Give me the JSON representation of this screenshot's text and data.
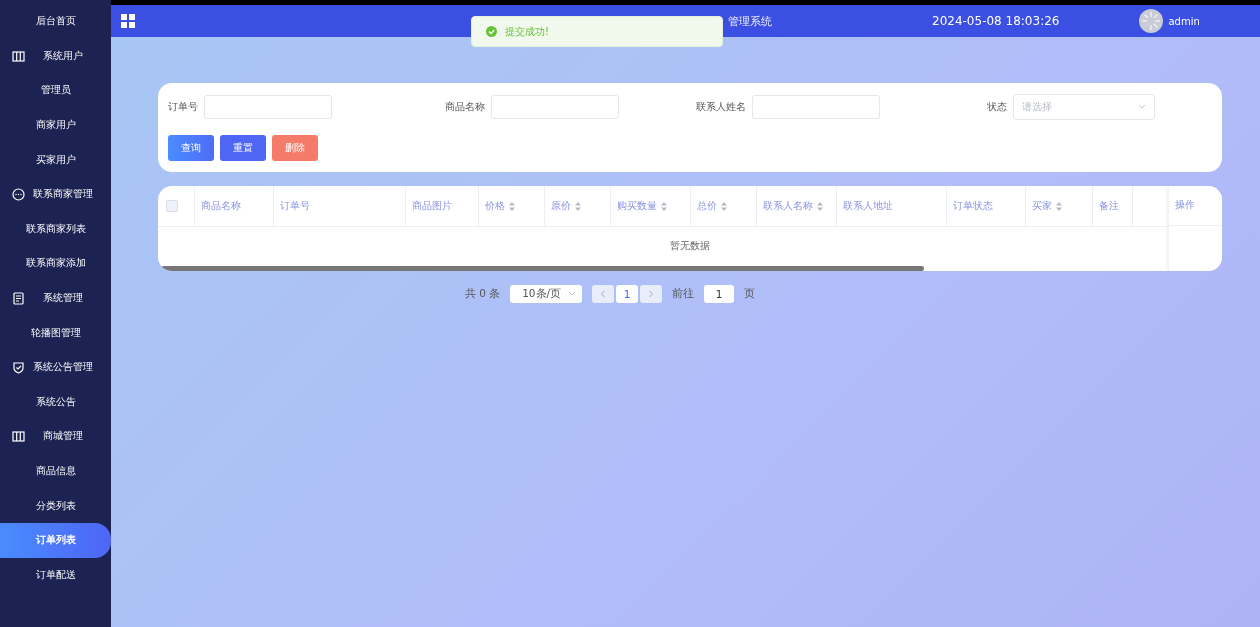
{
  "sidebar": {
    "items": [
      {
        "label": "后台首页",
        "kind": "item",
        "selected": false
      },
      {
        "label": "系统用户",
        "kind": "columns",
        "selected": false
      },
      {
        "label": "管理员",
        "kind": "item",
        "selected": false
      },
      {
        "label": "商家用户",
        "kind": "item",
        "selected": false
      },
      {
        "label": "买家用户",
        "kind": "item",
        "selected": false
      },
      {
        "label": "联系商家管理",
        "kind": "chat",
        "selected": false
      },
      {
        "label": "联系商家列表",
        "kind": "item",
        "selected": false
      },
      {
        "label": "联系商家添加",
        "kind": "item",
        "selected": false
      },
      {
        "label": "系统管理",
        "kind": "document",
        "selected": false
      },
      {
        "label": "轮播图管理",
        "kind": "item",
        "selected": false
      },
      {
        "label": "系统公告管理",
        "kind": "shield",
        "selected": false
      },
      {
        "label": "系统公告",
        "kind": "item",
        "selected": false
      },
      {
        "label": "商城管理",
        "kind": "columns",
        "selected": false
      },
      {
        "label": "商品信息",
        "kind": "item",
        "selected": false
      },
      {
        "label": "分类列表",
        "kind": "item",
        "selected": false
      },
      {
        "label": "订单列表",
        "kind": "item",
        "selected": true
      },
      {
        "label": "订单配送",
        "kind": "item",
        "selected": false
      }
    ]
  },
  "header": {
    "title": "管理系统",
    "datetime": "2024-05-08 18:03:26",
    "user": "admin"
  },
  "toast": {
    "message": "提交成功!"
  },
  "search": {
    "fields": [
      {
        "label": "订单号",
        "kind": "input"
      },
      {
        "label": "商品名称",
        "kind": "input"
      },
      {
        "label": "联系人姓名",
        "kind": "input"
      },
      {
        "label": "状态",
        "kind": "select",
        "placeholder": "请选择"
      }
    ],
    "buttons": [
      {
        "label": "查询",
        "kind": "query"
      },
      {
        "label": "重置",
        "kind": "reset"
      },
      {
        "label": "删除",
        "kind": "delete"
      }
    ]
  },
  "table": {
    "select_all_checked": false,
    "columns": [
      {
        "label": "商品名称",
        "sortable": false
      },
      {
        "label": "订单号",
        "sortable": false
      },
      {
        "label": "商品图片",
        "sortable": false
      },
      {
        "label": "价格",
        "sortable": true
      },
      {
        "label": "原价",
        "sortable": true
      },
      {
        "label": "购买数量",
        "sortable": true
      },
      {
        "label": "总价",
        "sortable": true
      },
      {
        "label": "联系人名称",
        "sortable": true
      },
      {
        "label": "联系人地址",
        "sortable": false
      },
      {
        "label": "订单状态",
        "sortable": false
      },
      {
        "label": "买家",
        "sortable": true
      },
      {
        "label": "备注",
        "sortable": false
      },
      {
        "label": "操作",
        "sortable": false
      }
    ],
    "empty_text": "暂无数据"
  },
  "pagination": {
    "total": "共 0 条",
    "page_size": "10条/页",
    "pages": [
      {
        "label": "1",
        "selected": true
      }
    ],
    "goto_label": "前往",
    "goto_value": "1",
    "page_suffix": "页"
  }
}
